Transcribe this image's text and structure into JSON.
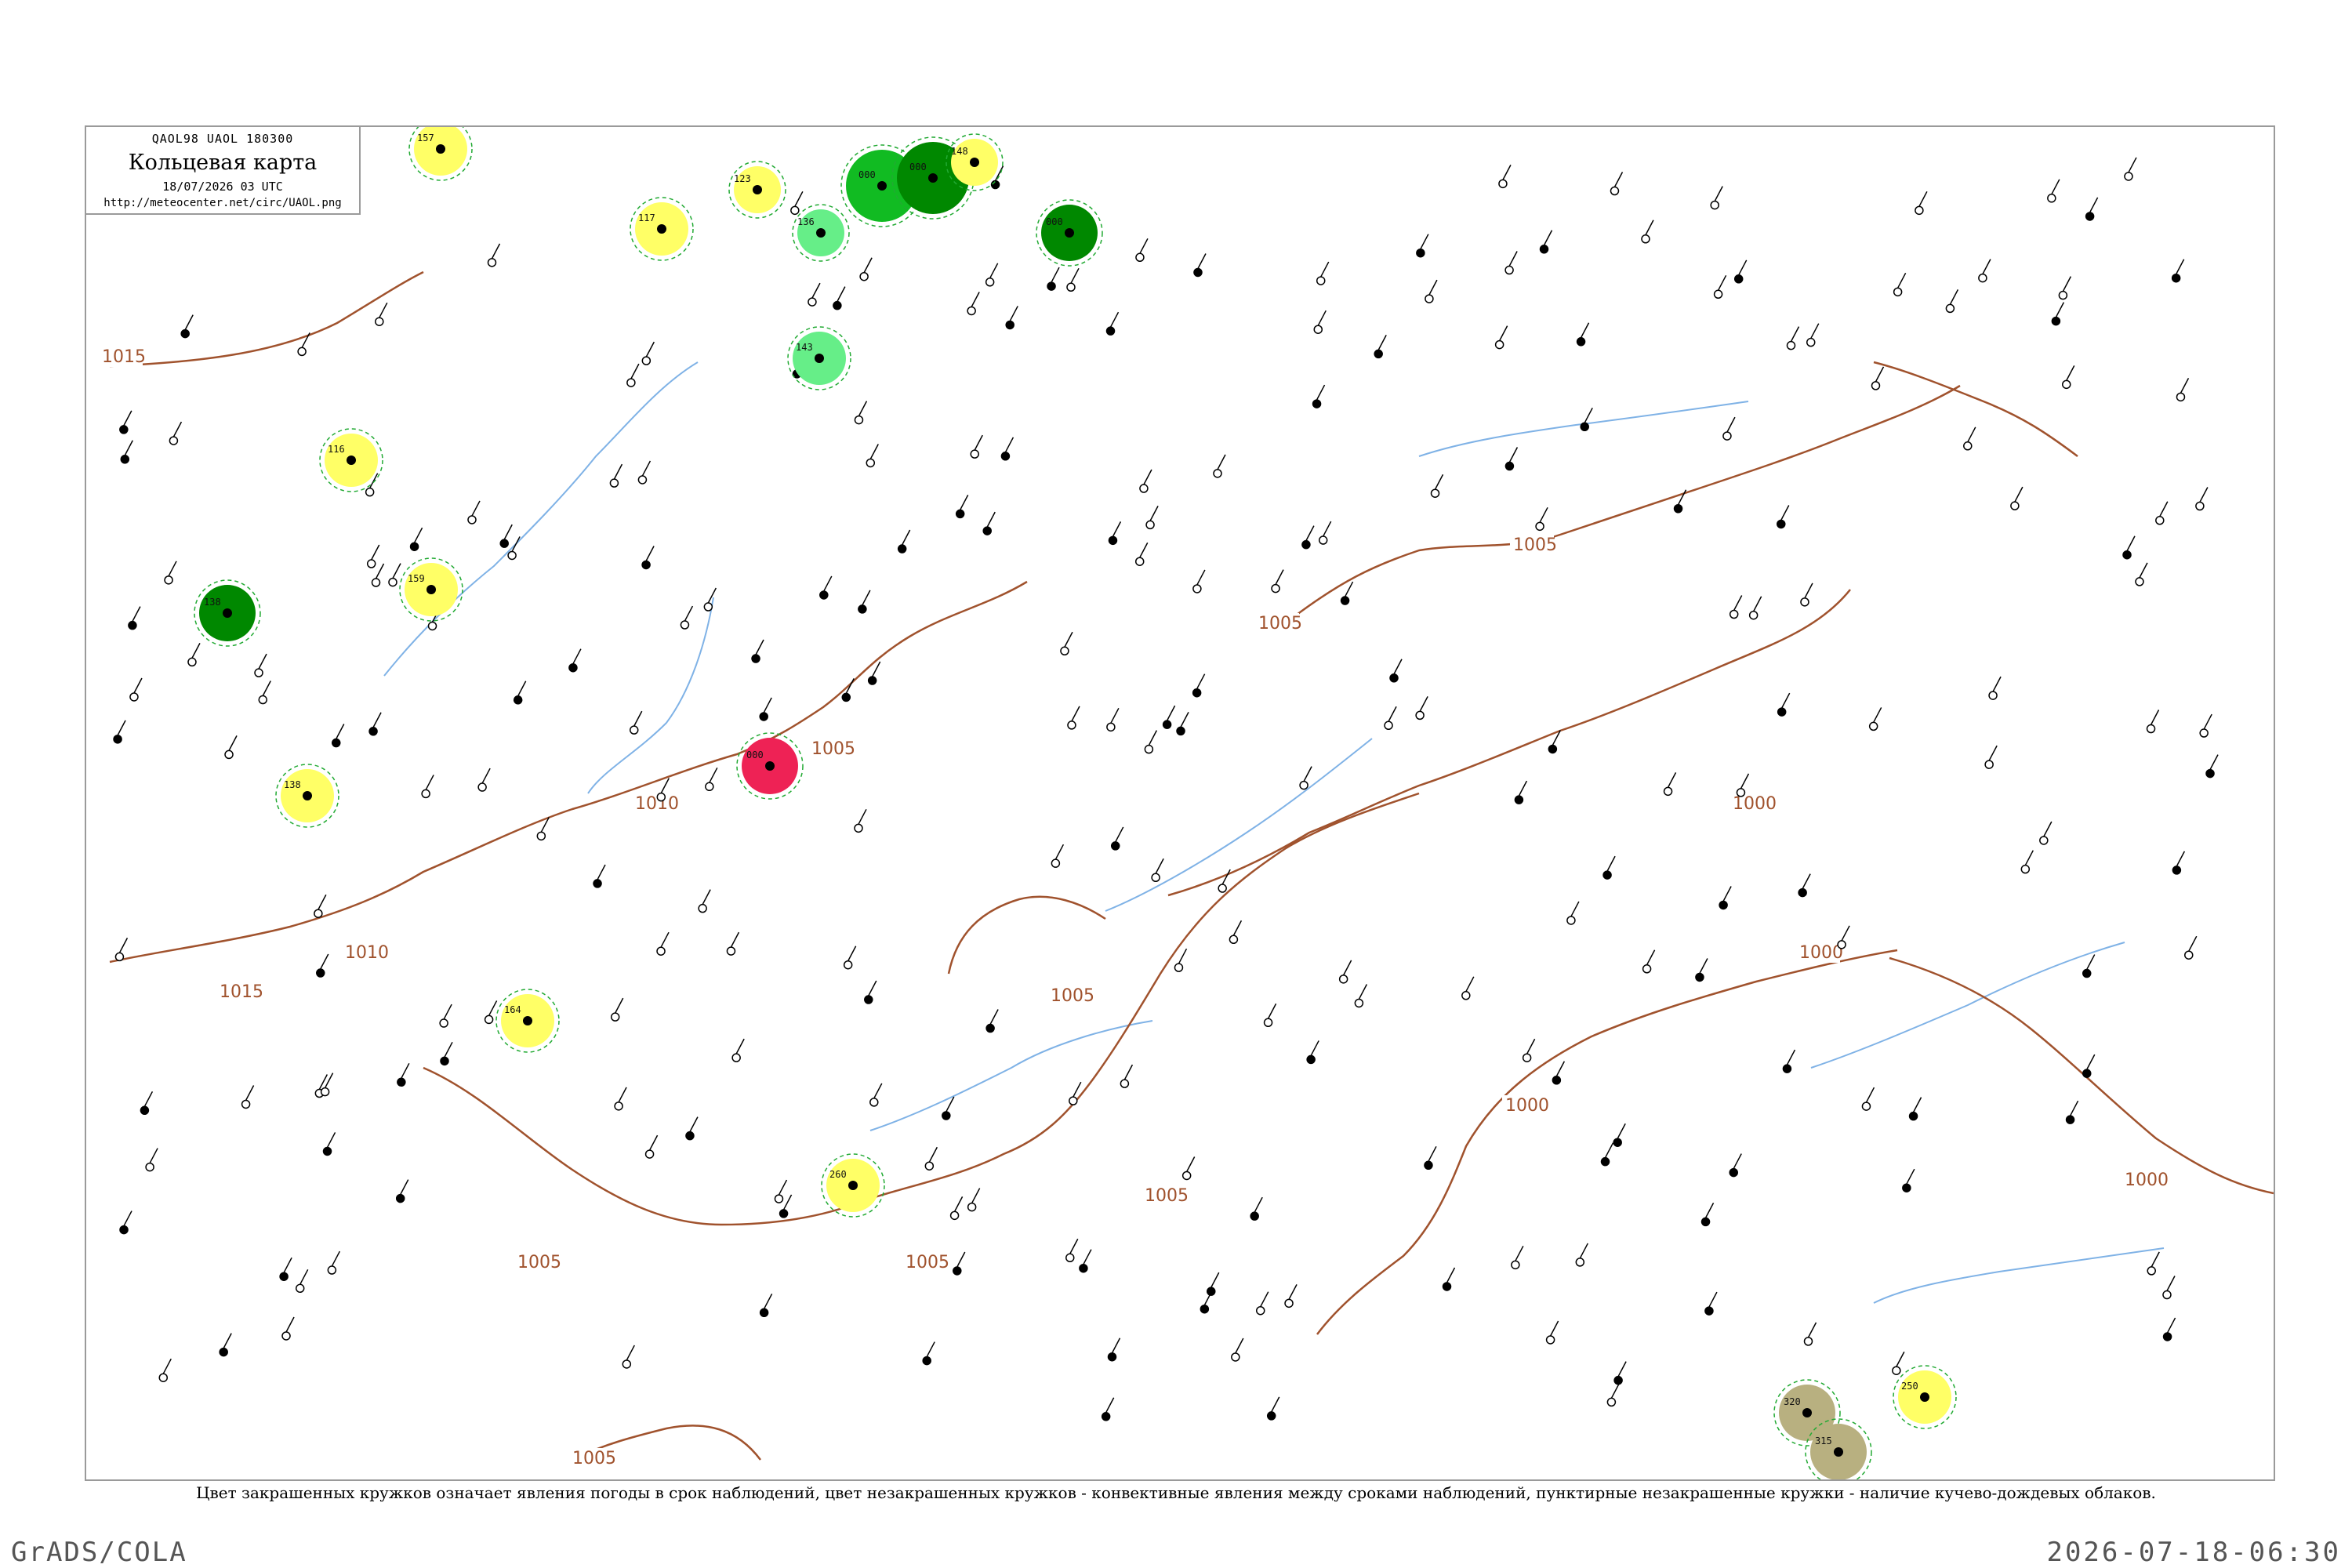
{
  "header": {
    "code_line": "QAOL98  UAOL  180300",
    "title": "Кольцевая карта",
    "datetime": "18/07/2026 03 UTC",
    "url": "http://meteocenter.net/circ/UAOL.png"
  },
  "isobars": [
    {
      "label": "1015"
    },
    {
      "label": "1010"
    },
    {
      "label": "1005"
    },
    {
      "label": "1005"
    },
    {
      "label": "1005"
    },
    {
      "label": "1005"
    },
    {
      "label": "1005"
    },
    {
      "label": "1005"
    },
    {
      "label": "1005"
    },
    {
      "label": "1000"
    },
    {
      "label": "1000"
    },
    {
      "label": "1000"
    },
    {
      "label": "1000"
    },
    {
      "label": "1005"
    },
    {
      "label": "1010"
    },
    {
      "label": "1015"
    }
  ],
  "colors": {
    "isobar": "#a0522d",
    "river": "#7fb2e6",
    "yellow": "#ffff66",
    "light_green": "#66ee88",
    "green": "#11bb22",
    "dark_green": "#008800",
    "red": "#ee2255",
    "olive": "#b8b080",
    "dashed_circle": "#22aa33"
  },
  "station_circles": [
    {
      "fill": "yellow",
      "value": "157"
    },
    {
      "fill": "yellow",
      "value": "117"
    },
    {
      "fill": "yellow",
      "value": "116"
    },
    {
      "fill": "yellow",
      "value": "159"
    },
    {
      "fill": "dark_green",
      "value": "138"
    },
    {
      "fill": "yellow",
      "value": "138"
    },
    {
      "fill": "red",
      "value": "000"
    },
    {
      "fill": "yellow",
      "value": "164"
    },
    {
      "fill": "yellow",
      "value": "260"
    },
    {
      "fill": "light_green",
      "value": "143"
    },
    {
      "fill": "light_green",
      "value": "136"
    },
    {
      "fill": "yellow",
      "value": "123"
    },
    {
      "fill": "green",
      "value": "000"
    },
    {
      "fill": "dark_green",
      "value": "000"
    },
    {
      "fill": "dark_green",
      "value": "000"
    },
    {
      "fill": "yellow",
      "value": "148"
    },
    {
      "fill": "yellow",
      "value": "250"
    },
    {
      "fill": "olive",
      "value": "320"
    },
    {
      "fill": "olive",
      "value": "315"
    }
  ],
  "legend_note": "Цвет закрашенных кружков означает явления погоды в срок наблюдений, цвет незакрашенных кружков - конвективные явления между сроками наблюдений, пунктирные незакрашенные кружки - наличие кучево-дождевых облаков.",
  "footer": {
    "left": "GrADS/COLA",
    "right": "2026-07-18-06:30"
  }
}
